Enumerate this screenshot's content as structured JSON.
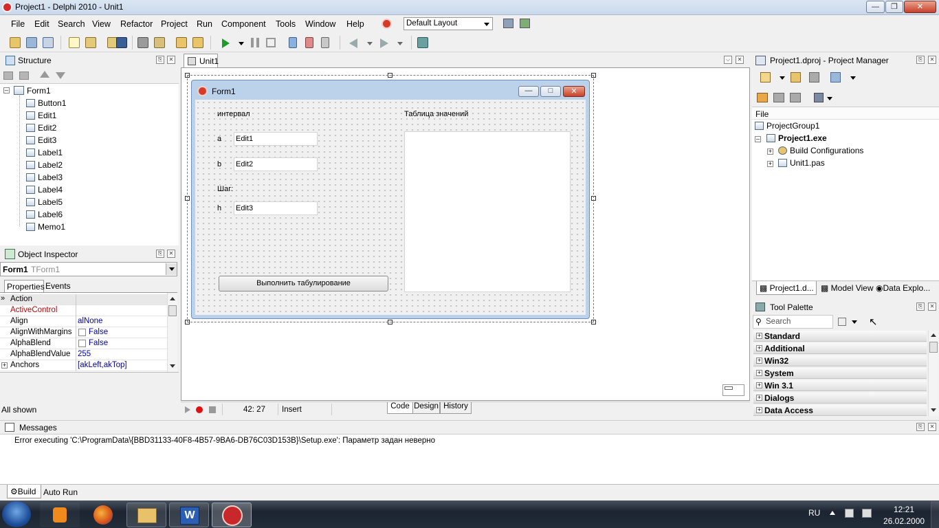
{
  "window": {
    "title": "Project1 - Delphi 2010 - Unit1",
    "min": "0",
    "max": "1",
    "close": "r"
  },
  "menu": [
    "File",
    "Edit",
    "Search",
    "View",
    "Refactor",
    "Project",
    "Run",
    "Component",
    "Tools",
    "Window",
    "Help"
  ],
  "layout_select": "Default Layout",
  "structure": {
    "title": "Structure",
    "root": "Form1",
    "items": [
      "Button1",
      "Edit1",
      "Edit2",
      "Edit3",
      "Label1",
      "Label2",
      "Label3",
      "Label4",
      "Label5",
      "Label6",
      "Memo1"
    ]
  },
  "object_inspector": {
    "title": "Object Inspector",
    "selected_name": "Form1",
    "selected_type": "TForm1",
    "tabs": [
      "Properties",
      "Events"
    ],
    "rows": [
      {
        "name": "Action",
        "value": ""
      },
      {
        "name": "ActiveControl",
        "value": ""
      },
      {
        "name": "Align",
        "value": "alNone"
      },
      {
        "name": "AlignWithMargins",
        "value": "False"
      },
      {
        "name": "AlphaBlend",
        "value": "False"
      },
      {
        "name": "AlphaBlendValue",
        "value": "255"
      },
      {
        "name": "Anchors",
        "value": "[akLeft,akTop]"
      }
    ],
    "status": "All shown"
  },
  "editor": {
    "tab": "Unit1",
    "status_pos": "42:  27",
    "status_mode": "Insert",
    "bottom_tabs": [
      "Code",
      "Design",
      "History"
    ]
  },
  "form": {
    "caption": "Form1",
    "label_interval": "интервал",
    "label_a": "a",
    "label_b": "b",
    "label_step": "Шаг:",
    "label_h": "h",
    "edit1": "Edit1",
    "edit2": "Edit2",
    "edit3": "Edit3",
    "label_table": "Таблица значений",
    "button": "Выполнить табулирование"
  },
  "project_manager": {
    "title": "Project1.dproj - Project Manager",
    "column": "File",
    "items": [
      "ProjectGroup1",
      "Project1.exe",
      "Build Configurations",
      "Unit1.pas"
    ],
    "tabs": [
      "Project1.d...",
      "Model View",
      "Data Explo..."
    ]
  },
  "tool_palette": {
    "title": "Tool Palette",
    "search_placeholder": "Search",
    "categories": [
      "Standard",
      "Additional",
      "Win32",
      "System",
      "Win 3.1",
      "Dialogs",
      "Data Access"
    ]
  },
  "messages": {
    "title": "Messages",
    "text": "Error executing 'C:\\ProgramData\\{BBD31133-40F8-4B57-9BA6-DB76C03D153B}\\Setup.exe': Параметр задан неверно",
    "tabs": [
      "Build",
      "Auto Run"
    ]
  },
  "taskbar": {
    "lang": "RU",
    "time": "12:21",
    "date": "26.02.2000"
  },
  "colors": {
    "accent": "#0000a0",
    "red_prop": "#c00000",
    "form_border": "#bcd1ea"
  }
}
